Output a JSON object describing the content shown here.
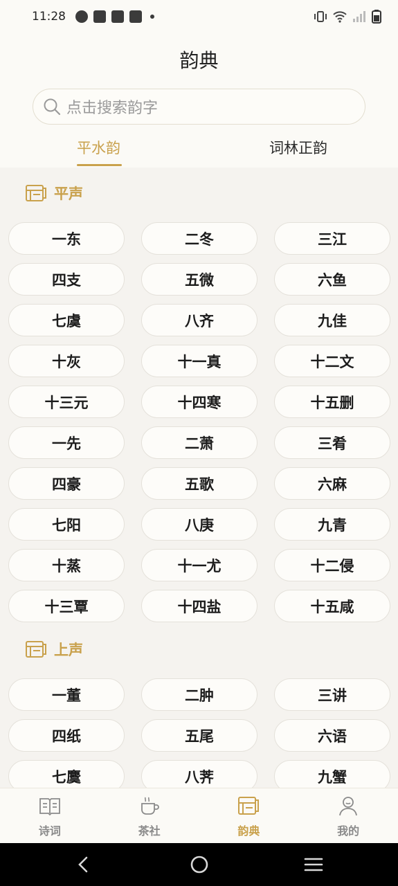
{
  "status_bar": {
    "time": "11:28"
  },
  "page_title": "韵典",
  "search": {
    "placeholder": "点击搜索韵字"
  },
  "tabs": [
    {
      "label": "平水韵",
      "active": true
    },
    {
      "label": "词林正韵",
      "active": false
    }
  ],
  "sections": [
    {
      "label": "平声",
      "items": [
        "一东",
        "二冬",
        "三江",
        "四支",
        "五微",
        "六鱼",
        "七虞",
        "八齐",
        "九佳",
        "十灰",
        "十一真",
        "十二文",
        "十三元",
        "十四寒",
        "十五删",
        "一先",
        "二萧",
        "三肴",
        "四豪",
        "五歌",
        "六麻",
        "七阳",
        "八庚",
        "九青",
        "十蒸",
        "十一尤",
        "十二侵",
        "十三覃",
        "十四盐",
        "十五咸"
      ]
    },
    {
      "label": "上声",
      "items": [
        "一董",
        "二肿",
        "三讲",
        "四纸",
        "五尾",
        "六语",
        "七麌",
        "八荠",
        "九蟹"
      ]
    }
  ],
  "bottom_nav": [
    {
      "label": "诗词",
      "icon": "book-icon",
      "active": false
    },
    {
      "label": "茶社",
      "icon": "tea-cup-icon",
      "active": false
    },
    {
      "label": "韵典",
      "icon": "dictionary-icon",
      "active": true
    },
    {
      "label": "我的",
      "icon": "profile-icon",
      "active": false
    }
  ],
  "colors": {
    "accent": "#c9a14c",
    "background": "#fbfaf6",
    "content_background": "#f5f3ef"
  }
}
